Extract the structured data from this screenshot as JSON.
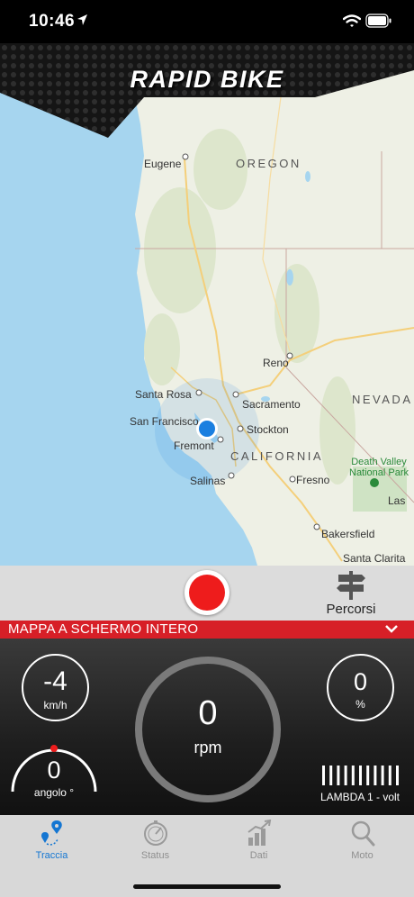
{
  "status_bar": {
    "time": "10:46"
  },
  "header": {
    "brand": "RAPID BIKE"
  },
  "map": {
    "labels": {
      "eugene": "Eugene",
      "oregon": "OREGON",
      "reno": "Reno",
      "nevada": "NEVADA",
      "santa_rosa": "Santa Rosa",
      "sacramento": "Sacramento",
      "san_francisco": "San Francisco",
      "stockton": "Stockton",
      "fremont": "Fremont",
      "california": "CALIFORNIA",
      "salinas": "Salinas",
      "fresno": "Fresno",
      "death_valley_1": "Death Valley",
      "death_valley_2": "National Park",
      "las": "Las",
      "bakersfield": "Bakersfield",
      "santa_clarita": "Santa Clarita"
    }
  },
  "controls": {
    "percorsi_label": "Percorsi"
  },
  "fullscreen_bar": {
    "label": "MAPPA A SCHERMO INTERO"
  },
  "dashboard": {
    "speed": {
      "value": "-4",
      "unit": "km/h"
    },
    "rpm": {
      "value": "0",
      "unit": "rpm"
    },
    "percent": {
      "value": "0",
      "unit": "%"
    },
    "angle": {
      "value": "0",
      "label": "angolo °"
    },
    "lambda": {
      "label": "LAMBDA 1 - volt",
      "bar_count": 11
    }
  },
  "tabs": [
    {
      "label": "Traccia",
      "icon": "track-icon",
      "active": true
    },
    {
      "label": "Status",
      "icon": "gauge-icon",
      "active": false
    },
    {
      "label": "Dati",
      "icon": "chart-icon",
      "active": false
    },
    {
      "label": "Moto",
      "icon": "search-icon",
      "active": false
    }
  ],
  "colors": {
    "accent_red": "#d71f27",
    "record_red": "#ee1c1c",
    "active_tab": "#1476d2",
    "inactive_tab": "#8f8f8f",
    "location_blue": "#1a7fe0"
  }
}
